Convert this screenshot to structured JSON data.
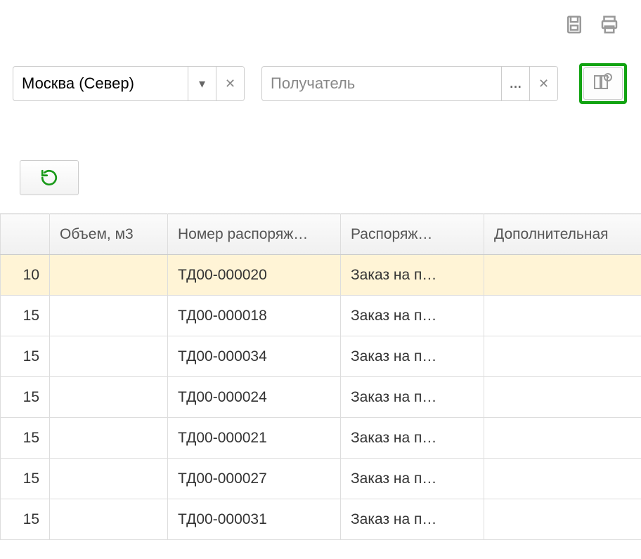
{
  "filters": {
    "warehouse": {
      "value": "Москва (Север)"
    },
    "recipient": {
      "placeholder": "Получатель"
    }
  },
  "table": {
    "headers": {
      "volume": "Объем, м3",
      "order_no": "Номер распоряж…",
      "disposition": "Распоряж…",
      "extra": "Дополнительная"
    },
    "rows": [
      {
        "num": "10",
        "volume": "",
        "order_no": "ТД00-000020",
        "disposition": "Заказ на п…",
        "extra": "",
        "selected": true
      },
      {
        "num": "15",
        "volume": "",
        "order_no": "ТД00-000018",
        "disposition": "Заказ на п…",
        "extra": ""
      },
      {
        "num": "15",
        "volume": "",
        "order_no": "ТД00-000034",
        "disposition": "Заказ на п…",
        "extra": ""
      },
      {
        "num": "15",
        "volume": "",
        "order_no": "ТД00-000024",
        "disposition": "Заказ на п…",
        "extra": ""
      },
      {
        "num": "15",
        "volume": "",
        "order_no": "ТД00-000021",
        "disposition": "Заказ на п…",
        "extra": ""
      },
      {
        "num": "15",
        "volume": "",
        "order_no": "ТД00-000027",
        "disposition": "Заказ на п…",
        "extra": ""
      },
      {
        "num": "15",
        "volume": "",
        "order_no": "ТД00-000031",
        "disposition": "Заказ на п…",
        "extra": ""
      }
    ]
  }
}
